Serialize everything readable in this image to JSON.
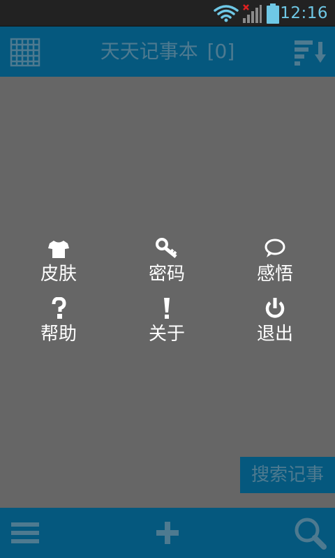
{
  "status_bar": {
    "time": "12:16",
    "icons": [
      "wifi-icon",
      "signal-no-service-icon",
      "battery-icon"
    ]
  },
  "top_bar": {
    "title": "天天记事本",
    "count": "[0]",
    "left_icon": "grid-icon",
    "right_icon": "sort-descending-icon"
  },
  "menu": {
    "items": [
      {
        "label": "皮肤",
        "icon": "tshirt-icon"
      },
      {
        "label": "密码",
        "icon": "key-icon"
      },
      {
        "label": "感悟",
        "icon": "speech-bubble-icon"
      },
      {
        "label": "帮助",
        "icon": "question-icon"
      },
      {
        "label": "关于",
        "icon": "exclamation-icon"
      },
      {
        "label": "退出",
        "icon": "power-icon"
      }
    ]
  },
  "search_tab": {
    "label": "搜索记事"
  },
  "bottom_bar": {
    "icons": [
      "hamburger-menu-icon",
      "add-icon",
      "search-icon"
    ]
  },
  "colors": {
    "bar": "#05587e",
    "background": "#666666",
    "status_bar": "#222222",
    "muted_text": "#4e7a90",
    "clock": "#6fc8e6"
  }
}
